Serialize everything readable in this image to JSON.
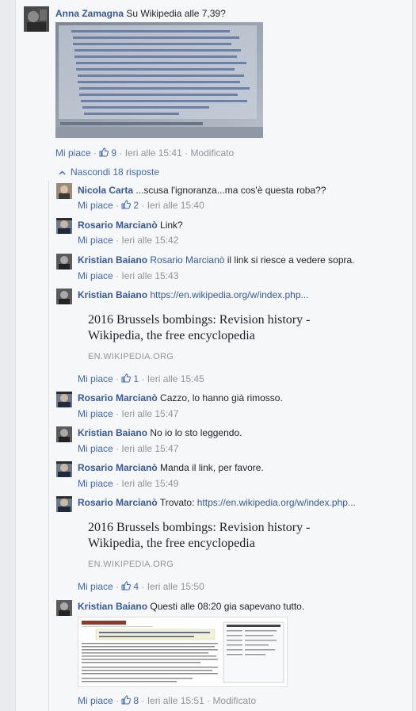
{
  "top_comment": {
    "author": "Anna Zamagna",
    "text": "Su Wikipedia alle 7,39?",
    "like_label": "Mi piace",
    "like_count": "9",
    "time": "Ieri alle 15:41",
    "edited": "Modificato"
  },
  "hide_replies_label": "Nascondi 18 risposte",
  "replies": [
    {
      "id": "r1",
      "author": "Nicola Carta",
      "text": "...scusa l'ignoranza...ma cos'è questa roba??",
      "like_label": "Mi piace",
      "like_count": "2",
      "time": "Ieri alle 15:40"
    },
    {
      "id": "r2",
      "author": "Rosario Marcianò",
      "text": "Link?",
      "like_label": "Mi piace",
      "time": "Ieri alle 15:42"
    },
    {
      "id": "r3",
      "author": "Kristian Baiano",
      "mention": "Rosario Marcianò",
      "text": "il link si riesce a vedere sopra.",
      "like_label": "Mi piace",
      "time": "Ieri alle 15:43"
    },
    {
      "id": "r4",
      "author": "Kristian Baiano",
      "link": "https://en.wikipedia.org/w/index.php...",
      "preview_title": "2016 Brussels bombings: Revision history - Wikipedia, the free encyclopedia",
      "preview_domain": "EN.WIKIPEDIA.ORG",
      "like_label": "Mi piace",
      "like_count": "1",
      "time": "Ieri alle 15:45"
    },
    {
      "id": "r5",
      "author": "Rosario Marcianò",
      "text": "Cazzo, lo hanno già rimosso.",
      "like_label": "Mi piace",
      "time": "Ieri alle 15:47"
    },
    {
      "id": "r6",
      "author": "Kristian Baiano",
      "text": "No io lo sto leggendo.",
      "like_label": "Mi piace",
      "time": "Ieri alle 15:47"
    },
    {
      "id": "r7",
      "author": "Rosario Marcianò",
      "text": "Manda il link, per favore.",
      "like_label": "Mi piace",
      "time": "Ieri alle 15:49"
    },
    {
      "id": "r8",
      "author": "Rosario Marcianò",
      "text": "Trovato:",
      "link": "https://en.wikipedia.org/w/index.php...",
      "preview_title": "2016 Brussels bombings: Revision history - Wikipedia, the free encyclopedia",
      "preview_domain": "EN.WIKIPEDIA.ORG",
      "like_label": "Mi piace",
      "like_count": "4",
      "time": "Ieri alle 15:50"
    },
    {
      "id": "r9",
      "author": "Kristian Baiano",
      "text": "Questi alle 08:20 gia sapevano tutto.",
      "like_label": "Mi piace",
      "like_count": "8",
      "time": "Ieri alle 15:51",
      "edited": "Modificato"
    }
  ],
  "colors": {
    "name": "#365899",
    "meta": "#90949c",
    "action": "#4267b2",
    "background": "#f6f7f9"
  }
}
